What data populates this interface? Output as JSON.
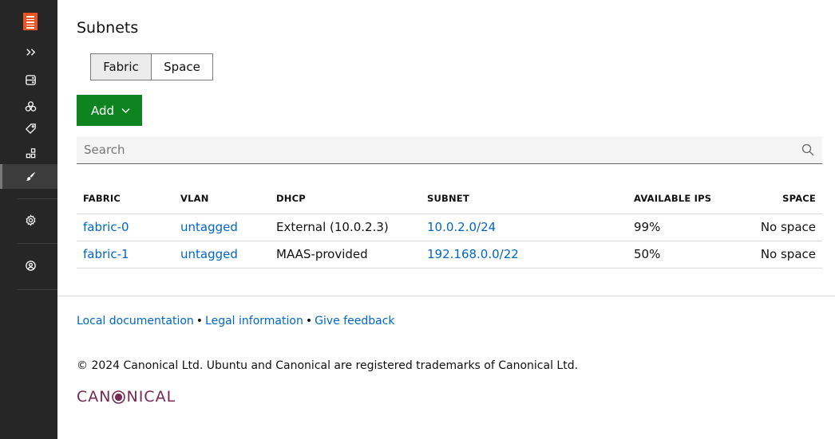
{
  "sidebar": {
    "logo_icon": "canonical-maas-logo",
    "items": [
      {
        "icon": "expand-icon"
      },
      {
        "icon": "machines-icon"
      },
      {
        "icon": "pools-icon"
      },
      {
        "icon": "tags-icon"
      },
      {
        "icon": "zones-icon"
      },
      {
        "icon": "networking-icon",
        "active": true
      },
      {
        "icon": "settings-icon"
      },
      {
        "icon": "account-icon"
      }
    ],
    "bg_color": "#262626",
    "logo_color": "#E95420"
  },
  "page": {
    "title": "Subnets"
  },
  "group_toggle": {
    "options": [
      "Fabric",
      "Space"
    ],
    "selected": "Fabric"
  },
  "add_button": {
    "label": "Add",
    "color": "#0e8420"
  },
  "search": {
    "placeholder": "Search",
    "value": ""
  },
  "table": {
    "headers": [
      "FABRIC",
      "VLAN",
      "DHCP",
      "SUBNET",
      "AVAILABLE IPS",
      "SPACE"
    ],
    "rows": [
      {
        "fabric": "fabric-0",
        "vlan": "untagged",
        "dhcp": "External (10.0.2.3)",
        "subnet": "10.0.2.0/24",
        "available_ips": "99%",
        "space": "No space"
      },
      {
        "fabric": "fabric-1",
        "vlan": "untagged",
        "dhcp": "MAAS-provided",
        "subnet": "192.168.0.0/22",
        "available_ips": "50%",
        "space": "No space"
      }
    ]
  },
  "footer": {
    "links": [
      "Local documentation",
      "Legal information",
      "Give feedback"
    ],
    "separator": "•",
    "copyright": "© 2024 Canonical Ltd. Ubuntu and Canonical are registered trademarks of Canonical Ltd.",
    "brand": {
      "before": "CAN",
      "after": "NICAL",
      "color": "#772953"
    }
  }
}
